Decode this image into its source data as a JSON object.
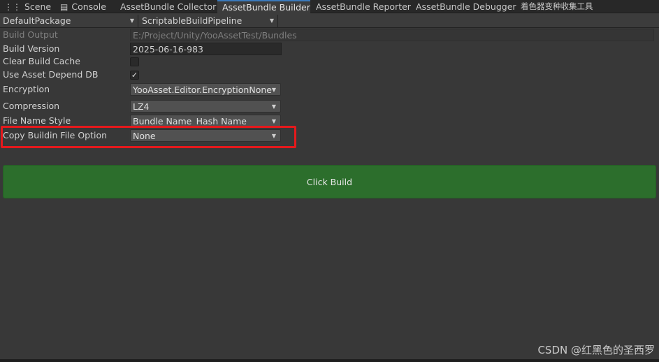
{
  "tabs": [
    {
      "label": "Scene",
      "icon": "grid-icon"
    },
    {
      "label": "Console",
      "icon": "console-icon"
    },
    {
      "label": "AssetBundle Collector"
    },
    {
      "label": "AssetBundle Builder",
      "active": true
    },
    {
      "label": "AssetBundle Reporter"
    },
    {
      "label": "AssetBundle Debugger"
    },
    {
      "label": "着色器变种收集工具"
    }
  ],
  "toolbar": {
    "package": "DefaultPackage",
    "pipeline": "ScriptableBuildPipeline"
  },
  "settings": {
    "build_output": {
      "label": "Build Output",
      "value": "E:/Project/Unity/YooAssetTest/Bundles"
    },
    "build_version": {
      "label": "Build Version",
      "value": "2025-06-16-983"
    },
    "clear_build_cache": {
      "label": "Clear Build Cache",
      "checked": false
    },
    "use_asset_depend_db": {
      "label": "Use Asset Depend DB",
      "checked": true
    },
    "encryption": {
      "label": "Encryption",
      "value": "YooAsset.Editor.EncryptionNone"
    },
    "compression": {
      "label": "Compression",
      "value": "LZ4"
    },
    "file_name_style": {
      "label": "File Name Style",
      "value": "Bundle Name_Hash Name"
    },
    "copy_buildin_file_option": {
      "label": "Copy Buildin File Option",
      "value": "None"
    }
  },
  "build_button": "Click Build",
  "watermark": "CSDN @红黑色的圣西罗",
  "colors": {
    "accent_tab": "#3a79bb",
    "build_button": "#2c6e2c",
    "highlight_box": "#e5191c"
  }
}
